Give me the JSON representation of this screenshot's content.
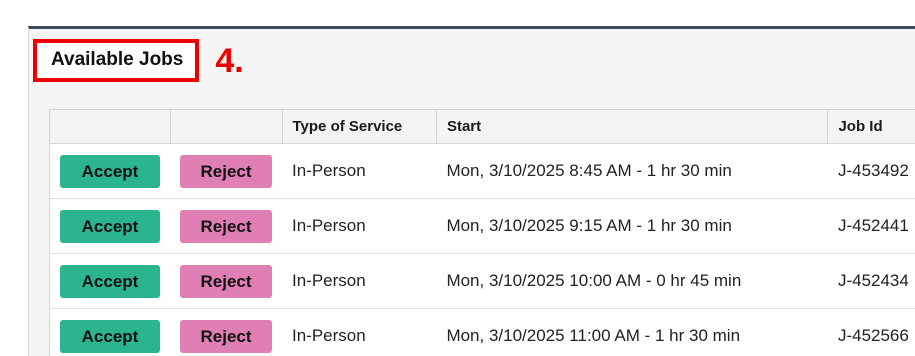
{
  "panel": {
    "title": "Available Jobs",
    "step_label": "4."
  },
  "table": {
    "columns": [
      "",
      "",
      "Type of Service",
      "Start",
      "Job Id"
    ],
    "rows": [
      {
        "accept": "Accept",
        "reject": "Reject",
        "type": "In-Person",
        "start": "Mon, 3/10/2025 8:45 AM - 1 hr 30 min",
        "job_id": "J-453492"
      },
      {
        "accept": "Accept",
        "reject": "Reject",
        "type": "In-Person",
        "start": "Mon, 3/10/2025 9:15 AM - 1 hr 30 min",
        "job_id": "J-452441"
      },
      {
        "accept": "Accept",
        "reject": "Reject",
        "type": "In-Person",
        "start": "Mon, 3/10/2025 10:00 AM - 0 hr 45 min",
        "job_id": "J-452434"
      },
      {
        "accept": "Accept",
        "reject": "Reject",
        "type": "In-Person",
        "start": "Mon, 3/10/2025 11:00 AM - 1 hr 30 min",
        "job_id": "J-452566"
      }
    ]
  },
  "colors": {
    "accept": "#2bb58f",
    "reject": "#e07fb4",
    "highlight": "#ee0000"
  }
}
